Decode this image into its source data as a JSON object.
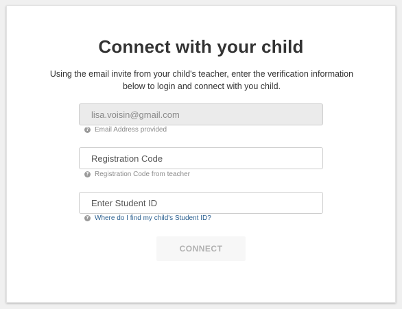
{
  "page": {
    "title": "Connect with your child",
    "subtitle": "Using the email invite from your child's teacher, enter the verification information below to login and connect with you child."
  },
  "form": {
    "email": {
      "value": "lisa.voisin@gmail.com",
      "hint": "Email Address provided",
      "disabled": true
    },
    "registration_code": {
      "placeholder": "Registration Code",
      "hint": "Registration Code from teacher"
    },
    "student_id": {
      "placeholder": "Enter Student ID",
      "hint_link": "Where do I find my child's Student ID?"
    },
    "connect_label": "CONNECT"
  },
  "icons": {
    "hint_icon": "question-circle-icon"
  },
  "colors": {
    "title": "#333333",
    "link": "#2a5f8f",
    "disabled_field_bg": "#ebebeb",
    "button_text_disabled": "#b0b0b0"
  }
}
